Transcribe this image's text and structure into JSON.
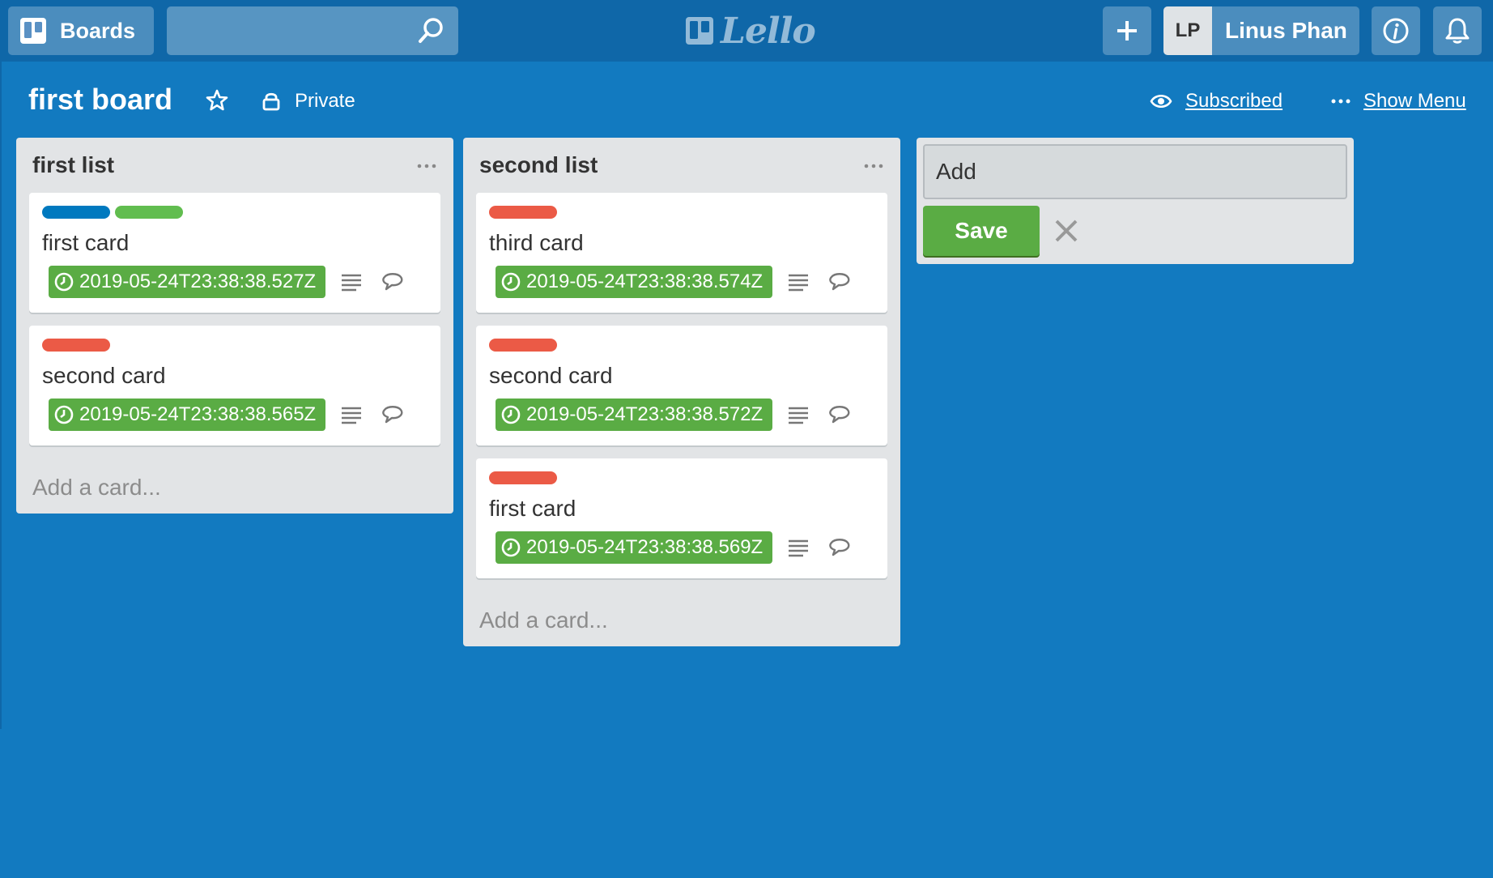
{
  "header": {
    "boards_label": "Boards",
    "search_placeholder": "",
    "logo_text": "Lello",
    "user_initials": "LP",
    "user_name": "Linus Phan"
  },
  "board": {
    "title": "first board",
    "privacy": "Private",
    "subscribed": "Subscribed",
    "show_menu": "Show Menu"
  },
  "lists": [
    {
      "title": "first list",
      "add_card": "Add a card...",
      "cards": [
        {
          "title": "first card",
          "labels": [
            "#0079bf",
            "#61bd4f"
          ],
          "due": "2019-05-24T23:38:38.527Z"
        },
        {
          "title": "second card",
          "labels": [
            "#eb5a46"
          ],
          "due": "2019-05-24T23:38:38.565Z"
        }
      ]
    },
    {
      "title": "second list",
      "add_card": "Add a card...",
      "cards": [
        {
          "title": "third card",
          "labels": [
            "#eb5a46"
          ],
          "due": "2019-05-24T23:38:38.574Z"
        },
        {
          "title": "second card",
          "labels": [
            "#eb5a46"
          ],
          "due": "2019-05-24T23:38:38.572Z"
        },
        {
          "title": "first card",
          "labels": [
            "#eb5a46"
          ],
          "due": "2019-05-24T23:38:38.569Z"
        }
      ]
    }
  ],
  "add_list": {
    "placeholder": "Add",
    "save_label": "Save"
  },
  "colors": {
    "board_bg": "#127ac0",
    "header_bg": "#0f67a8",
    "list_bg": "#e2e4e6",
    "due_green": "#5aac44",
    "label_blue": "#0079bf",
    "label_green": "#61bd4f",
    "label_red": "#eb5a46"
  },
  "icons": {
    "boards": "boards-icon",
    "search": "search-icon",
    "add": "plus-icon",
    "info": "info-icon",
    "notifications": "bell-icon",
    "star": "star-icon",
    "privacy": "lock-icon",
    "subscribed": "eye-icon",
    "menu": "more-icon",
    "due": "clock-icon",
    "description": "description-icon",
    "comment": "comment-icon",
    "cancel": "close-icon"
  }
}
